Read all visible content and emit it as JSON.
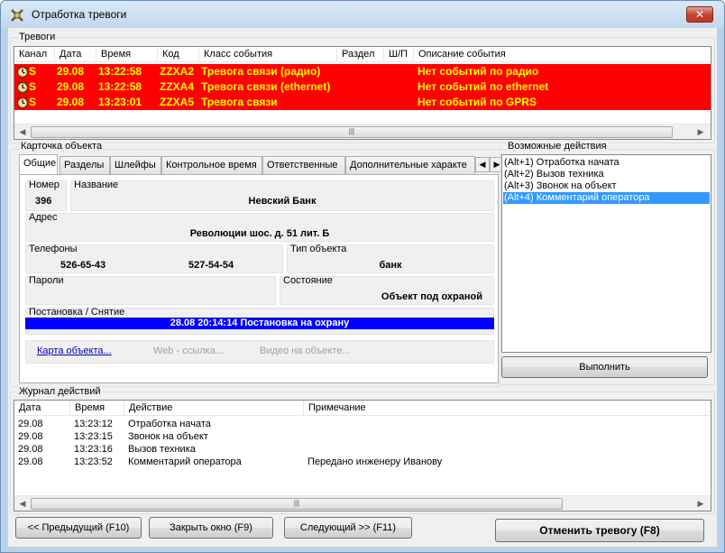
{
  "window": {
    "title": "Отработка тревоги",
    "close_label": "✕"
  },
  "alarms": {
    "group_label": "Тревоги",
    "columns": [
      "Канал",
      "Дата",
      "Время",
      "Код",
      "Класс события",
      "Раздел",
      "Ш/П",
      "Описание события"
    ],
    "rows": [
      {
        "channel": "S",
        "date": "29.08",
        "time": "13:22:58",
        "code": "ZZXA2",
        "event_class": "Тревога связи (радио)",
        "section": "",
        "sp": "",
        "description": "Нет событий по радио"
      },
      {
        "channel": "S",
        "date": "29.08",
        "time": "13:22:58",
        "code": "ZZXA4",
        "event_class": "Тревога связи (ethernet)",
        "section": "",
        "sp": "",
        "description": "Нет событий по ethernet"
      },
      {
        "channel": "S",
        "date": "29.08",
        "time": "13:23:01",
        "code": "ZZXA5",
        "event_class": "Тревога связи",
        "section": "",
        "sp": "",
        "description": "Нет событий по GPRS"
      }
    ],
    "row_color": "#ff0000",
    "text_color": "#ffff00"
  },
  "card": {
    "group_label": "Карточка объекта",
    "tabs": [
      "Общие",
      "Разделы",
      "Шлейфы",
      "Контрольное время",
      "Ответственные",
      "Дополнительные характе"
    ],
    "active_tab": "Общие",
    "number_label": "Номер",
    "number_value": "396",
    "name_label": "Название",
    "name_value": "Невский Банк",
    "address_label": "Адрес",
    "address_value": "Революции шос. д. 51 лит. Б",
    "phones_label": "Телефоны",
    "phone1": "526-65-43",
    "phone2": "527-54-54",
    "type_label": "Тип объекта",
    "type_value": "банк",
    "passwords_label": "Пароли",
    "state_label": "Состояние",
    "state_value": "Объект под охраной",
    "arming_label": "Постановка / Снятие",
    "arming_value": "28.08 20:14:14  Постановка на охрану",
    "link_map": "Карта объекта...",
    "link_web": "Web - ссылка...",
    "link_video": "Видео на объекте..."
  },
  "actions": {
    "group_label": "Возможные действия",
    "items": [
      "(Alt+1) Отработка начата",
      "(Alt+2) Вызов техника",
      "(Alt+3) Звонок на объект",
      "(Alt+4) Комментарий оператора"
    ],
    "selected_index": 3,
    "execute_label": "Выполнить"
  },
  "journal": {
    "group_label": "Журнал действий",
    "columns": [
      "Дата",
      "Время",
      "Действие",
      "Примечание"
    ],
    "rows": [
      {
        "date": "29.08",
        "time": "13:23:12",
        "action": "Отработка начата",
        "note": ""
      },
      {
        "date": "29.08",
        "time": "13:23:15",
        "action": "Звонок на объект",
        "note": ""
      },
      {
        "date": "29.08",
        "time": "13:23:16",
        "action": "Вызов техника",
        "note": ""
      },
      {
        "date": "29.08",
        "time": "13:23:52",
        "action": "Комментарий оператора",
        "note": "Передано инженеру Иванову"
      }
    ]
  },
  "footer": {
    "prev_label": "<< Предыдущий (F10)",
    "close_label": "Закрыть окно (F9)",
    "next_label": "Следующий >> (F11)",
    "cancel_label": "Отменить тревогу (F8)"
  }
}
